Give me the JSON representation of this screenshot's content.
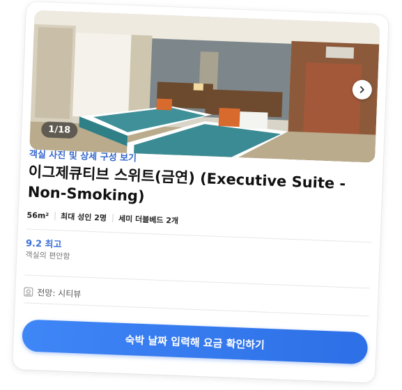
{
  "room": {
    "photo_counter": "1/18",
    "photo_link": "객실 사진 및 상세 구성 보기",
    "title": "이그제큐티브 스위트(금연) (Executive Suite - Non-Smoking)",
    "specs": {
      "size": "56m²",
      "occupancy": "최대 성인 2명",
      "beds": "세미 더블베드 2개"
    },
    "rating": {
      "score_label": "9.2 최고",
      "category": "객실의 편안함"
    },
    "view": "전망: 시티뷰",
    "cta_label": "숙박 날짜 입력해 요금 확인하기"
  },
  "colors": {
    "accent": "#3366cc",
    "rating": "#3a6fd8",
    "cta": "#2d6fe6"
  },
  "icons": {
    "next": "chevron-right-icon",
    "view": "view-icon"
  }
}
